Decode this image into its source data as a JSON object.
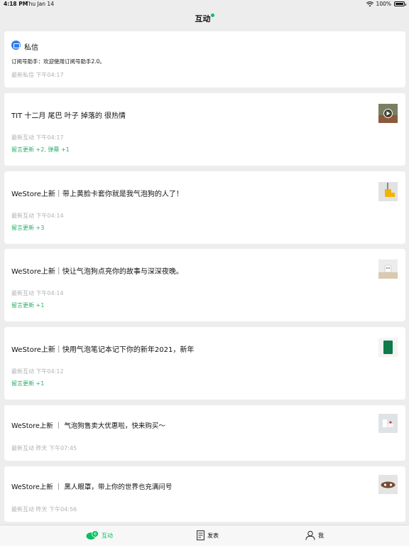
{
  "status_bar": {
    "time": "4:18 PM",
    "date": "Thu Jan 14",
    "battery": "100%"
  },
  "nav": {
    "title": "互动"
  },
  "private_message": {
    "title": "私信",
    "body": "订阅号助手：欢迎使用订阅号助手2.0。",
    "meta": "最新私信 下午04:17"
  },
  "items": [
    {
      "title": "TIT 十二月 尾巴 叶子 掉落的 很热情",
      "meta": "最新互动 下午04:17",
      "update": "留言更新 +2, 弹幕 +1",
      "thumb_icon": "video-thumbnail"
    },
    {
      "title": "WeStore上新｜带上黄脸卡套你就是我气泡狗的人了！",
      "meta": "最新互动 下午04:14",
      "update": "留言更新 +3",
      "thumb_icon": "card-holder-thumbnail"
    },
    {
      "title": "WeStore上新｜快让气泡狗点亮你的故事与深深夜晚。",
      "meta": "最新互动 下午04:14",
      "update": "留言更新 +1",
      "thumb_icon": "lamp-thumbnail"
    },
    {
      "title": "WeStore上新｜快用气泡笔记本记下你的新年2021，新年",
      "meta": "最新互动 下午04:12",
      "update": "留言更新 +1",
      "thumb_icon": "notebook-thumbnail"
    },
    {
      "title": "WeStore上新 ｜ 气泡狗售卖大优惠啦，快来购买～",
      "meta": "最新互动 昨天 下午07:45",
      "update": "",
      "thumb_icon": "product-thumbnail"
    },
    {
      "title": "WeStore上新 ｜ 黑人眼罩，带上你的世界也充满问号",
      "meta": "最新互动 昨天 下午04:56",
      "update": "",
      "thumb_icon": "eye-mask-thumbnail"
    }
  ],
  "tabs": [
    {
      "label": "互动",
      "badge": "6",
      "active": true
    },
    {
      "label": "发表",
      "active": false
    },
    {
      "label": "我",
      "active": false
    }
  ],
  "colors": {
    "accent": "#07c160",
    "update_text": "#2aae67",
    "mail_icon": "#2f7be5"
  }
}
